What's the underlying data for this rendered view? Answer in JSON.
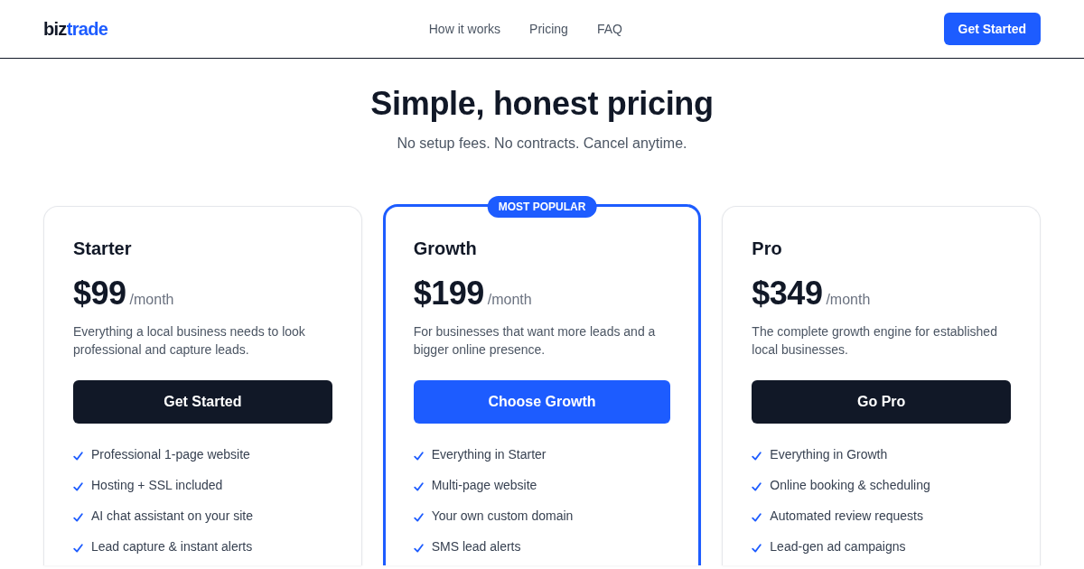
{
  "header": {
    "logo": {
      "text": "biz",
      "accent": "trade"
    },
    "nav": [
      "How it works",
      "Pricing",
      "FAQ"
    ],
    "cta": "Get Started"
  },
  "hero": {
    "title": "Simple, honest pricing",
    "subtitle": "No setup fees. No contracts. Cancel anytime."
  },
  "plans": [
    {
      "name": "Starter",
      "price": "$99",
      "period": "/month",
      "description": "Everything a local business needs to look professional and capture leads.",
      "button": "Get Started",
      "featured": false,
      "features": [
        "Professional 1-page website",
        "Hosting + SSL included",
        "AI chat assistant on your site",
        "Lead capture & instant alerts"
      ]
    },
    {
      "name": "Growth",
      "price": "$199",
      "period": "/month",
      "badge": "MOST POPULAR",
      "description": "For businesses that want more leads and a bigger online presence.",
      "button": "Choose Growth",
      "featured": true,
      "features": [
        "Everything in Starter",
        "Multi-page website",
        "Your own custom domain",
        "SMS lead alerts"
      ]
    },
    {
      "name": "Pro",
      "price": "$349",
      "period": "/month",
      "description": "The complete growth engine for established local businesses.",
      "button": "Go Pro",
      "featured": false,
      "features": [
        "Everything in Growth",
        "Online booking & scheduling",
        "Automated review requests",
        "Lead-gen ad campaigns"
      ]
    }
  ]
}
